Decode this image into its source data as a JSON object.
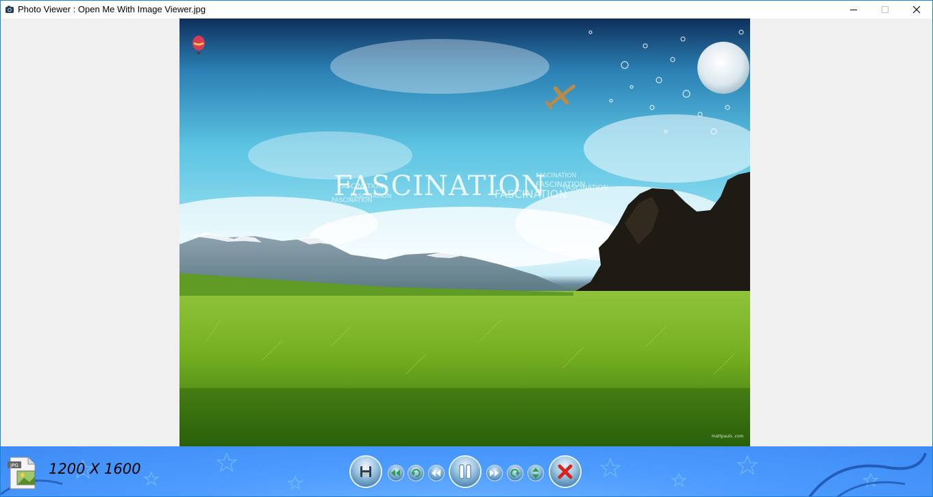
{
  "window": {
    "title": "Photo Viewer : Open Me With Image Viewer.jpg"
  },
  "photo": {
    "banner_text": "FASCINATION",
    "small_texts": [
      "FASCINATION",
      "FASCINATION",
      "FASCINATION",
      "FASCINATION",
      "FASCINATION",
      "FASCINATION",
      "FASCINATION"
    ],
    "watermark": "mattpauls\n.com"
  },
  "toolbar": {
    "file_type": "JPG",
    "dimensions": "1200 X 1600",
    "buttons": [
      {
        "name": "save",
        "icon": "save-icon"
      },
      {
        "name": "first",
        "icon": "double-arrow-left-icon"
      },
      {
        "name": "rotate-left",
        "icon": "rotate-left-icon"
      },
      {
        "name": "previous",
        "icon": "rewind-icon"
      },
      {
        "name": "pause",
        "icon": "pause-icon"
      },
      {
        "name": "next",
        "icon": "fast-forward-icon"
      },
      {
        "name": "rotate-right",
        "icon": "rotate-right-icon"
      },
      {
        "name": "flip",
        "icon": "flip-vertical-icon"
      },
      {
        "name": "close",
        "icon": "close-x-icon"
      }
    ]
  },
  "colors": {
    "toolbar_bg": "#4d9cff",
    "window_border": "#1883d7",
    "close_red": "#d9241c"
  }
}
